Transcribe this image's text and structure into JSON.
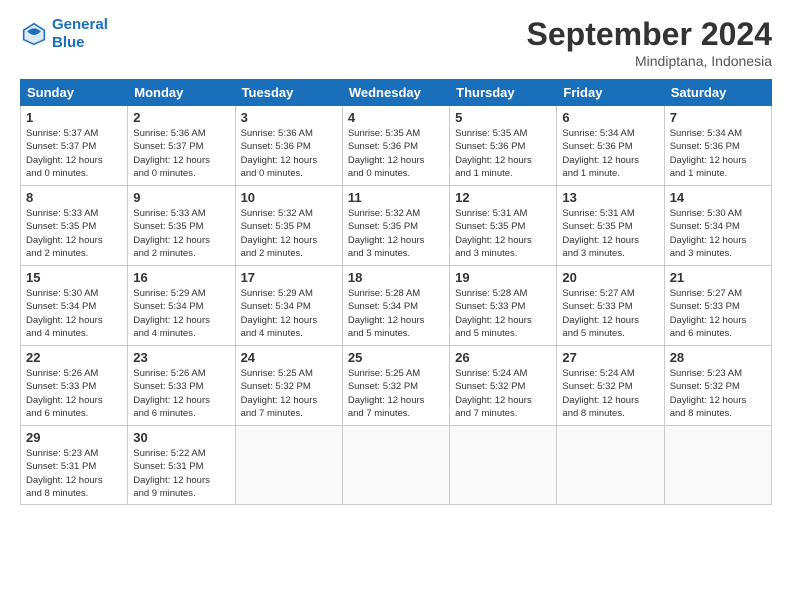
{
  "header": {
    "logo_line1": "General",
    "logo_line2": "Blue",
    "month_title": "September 2024",
    "location": "Mindiptana, Indonesia"
  },
  "columns": [
    "Sunday",
    "Monday",
    "Tuesday",
    "Wednesday",
    "Thursday",
    "Friday",
    "Saturday"
  ],
  "weeks": [
    [
      {
        "day": "1",
        "info": "Sunrise: 5:37 AM\nSunset: 5:37 PM\nDaylight: 12 hours\nand 0 minutes."
      },
      {
        "day": "2",
        "info": "Sunrise: 5:36 AM\nSunset: 5:37 PM\nDaylight: 12 hours\nand 0 minutes."
      },
      {
        "day": "3",
        "info": "Sunrise: 5:36 AM\nSunset: 5:36 PM\nDaylight: 12 hours\nand 0 minutes."
      },
      {
        "day": "4",
        "info": "Sunrise: 5:35 AM\nSunset: 5:36 PM\nDaylight: 12 hours\nand 0 minutes."
      },
      {
        "day": "5",
        "info": "Sunrise: 5:35 AM\nSunset: 5:36 PM\nDaylight: 12 hours\nand 1 minute."
      },
      {
        "day": "6",
        "info": "Sunrise: 5:34 AM\nSunset: 5:36 PM\nDaylight: 12 hours\nand 1 minute."
      },
      {
        "day": "7",
        "info": "Sunrise: 5:34 AM\nSunset: 5:36 PM\nDaylight: 12 hours\nand 1 minute."
      }
    ],
    [
      {
        "day": "8",
        "info": "Sunrise: 5:33 AM\nSunset: 5:35 PM\nDaylight: 12 hours\nand 2 minutes."
      },
      {
        "day": "9",
        "info": "Sunrise: 5:33 AM\nSunset: 5:35 PM\nDaylight: 12 hours\nand 2 minutes."
      },
      {
        "day": "10",
        "info": "Sunrise: 5:32 AM\nSunset: 5:35 PM\nDaylight: 12 hours\nand 2 minutes."
      },
      {
        "day": "11",
        "info": "Sunrise: 5:32 AM\nSunset: 5:35 PM\nDaylight: 12 hours\nand 3 minutes."
      },
      {
        "day": "12",
        "info": "Sunrise: 5:31 AM\nSunset: 5:35 PM\nDaylight: 12 hours\nand 3 minutes."
      },
      {
        "day": "13",
        "info": "Sunrise: 5:31 AM\nSunset: 5:35 PM\nDaylight: 12 hours\nand 3 minutes."
      },
      {
        "day": "14",
        "info": "Sunrise: 5:30 AM\nSunset: 5:34 PM\nDaylight: 12 hours\nand 3 minutes."
      }
    ],
    [
      {
        "day": "15",
        "info": "Sunrise: 5:30 AM\nSunset: 5:34 PM\nDaylight: 12 hours\nand 4 minutes."
      },
      {
        "day": "16",
        "info": "Sunrise: 5:29 AM\nSunset: 5:34 PM\nDaylight: 12 hours\nand 4 minutes."
      },
      {
        "day": "17",
        "info": "Sunrise: 5:29 AM\nSunset: 5:34 PM\nDaylight: 12 hours\nand 4 minutes."
      },
      {
        "day": "18",
        "info": "Sunrise: 5:28 AM\nSunset: 5:34 PM\nDaylight: 12 hours\nand 5 minutes."
      },
      {
        "day": "19",
        "info": "Sunrise: 5:28 AM\nSunset: 5:33 PM\nDaylight: 12 hours\nand 5 minutes."
      },
      {
        "day": "20",
        "info": "Sunrise: 5:27 AM\nSunset: 5:33 PM\nDaylight: 12 hours\nand 5 minutes."
      },
      {
        "day": "21",
        "info": "Sunrise: 5:27 AM\nSunset: 5:33 PM\nDaylight: 12 hours\nand 6 minutes."
      }
    ],
    [
      {
        "day": "22",
        "info": "Sunrise: 5:26 AM\nSunset: 5:33 PM\nDaylight: 12 hours\nand 6 minutes."
      },
      {
        "day": "23",
        "info": "Sunrise: 5:26 AM\nSunset: 5:33 PM\nDaylight: 12 hours\nand 6 minutes."
      },
      {
        "day": "24",
        "info": "Sunrise: 5:25 AM\nSunset: 5:32 PM\nDaylight: 12 hours\nand 7 minutes."
      },
      {
        "day": "25",
        "info": "Sunrise: 5:25 AM\nSunset: 5:32 PM\nDaylight: 12 hours\nand 7 minutes."
      },
      {
        "day": "26",
        "info": "Sunrise: 5:24 AM\nSunset: 5:32 PM\nDaylight: 12 hours\nand 7 minutes."
      },
      {
        "day": "27",
        "info": "Sunrise: 5:24 AM\nSunset: 5:32 PM\nDaylight: 12 hours\nand 8 minutes."
      },
      {
        "day": "28",
        "info": "Sunrise: 5:23 AM\nSunset: 5:32 PM\nDaylight: 12 hours\nand 8 minutes."
      }
    ],
    [
      {
        "day": "29",
        "info": "Sunrise: 5:23 AM\nSunset: 5:31 PM\nDaylight: 12 hours\nand 8 minutes."
      },
      {
        "day": "30",
        "info": "Sunrise: 5:22 AM\nSunset: 5:31 PM\nDaylight: 12 hours\nand 9 minutes."
      },
      {
        "day": "",
        "info": ""
      },
      {
        "day": "",
        "info": ""
      },
      {
        "day": "",
        "info": ""
      },
      {
        "day": "",
        "info": ""
      },
      {
        "day": "",
        "info": ""
      }
    ]
  ]
}
